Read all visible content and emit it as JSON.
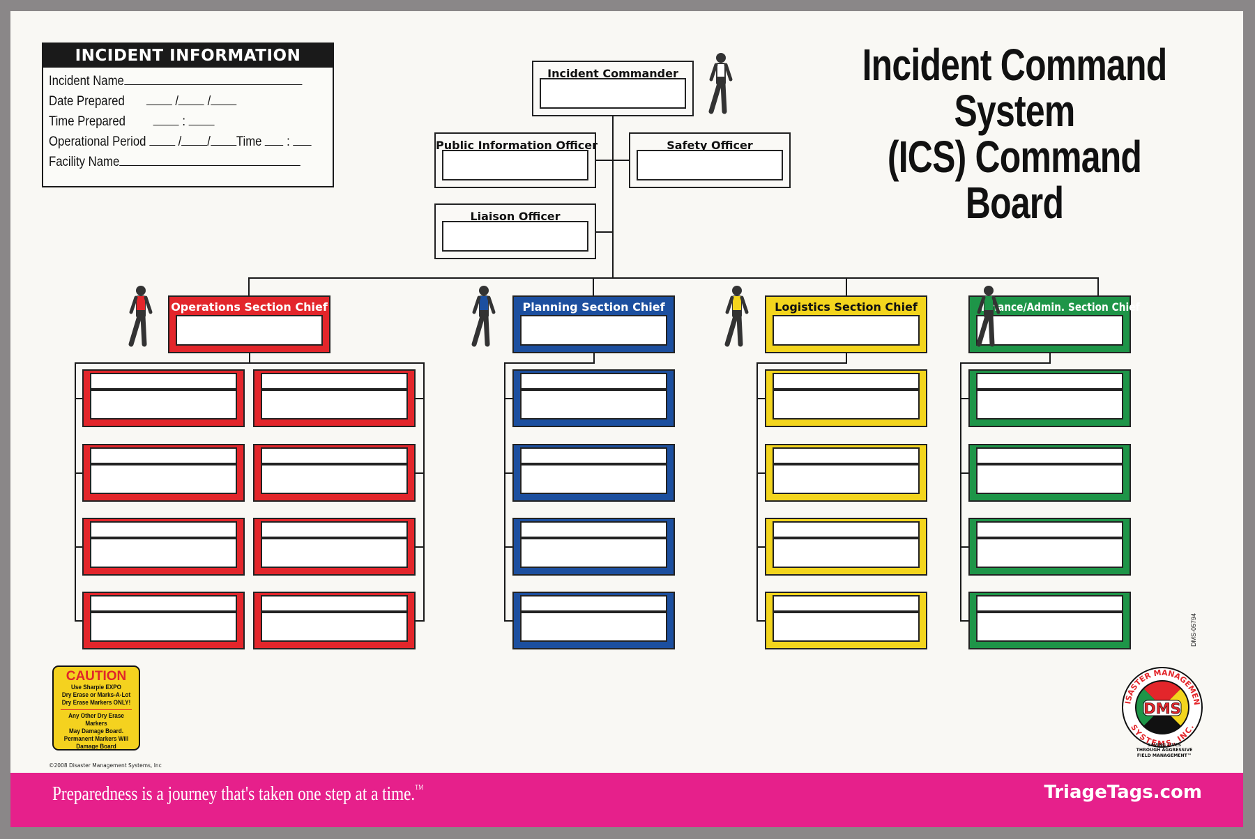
{
  "incident_info": {
    "header": "INCIDENT INFORMATION",
    "fields": {
      "incident_name": "Incident Name",
      "date_prepared": "Date Prepared",
      "time_prepared": "Time Prepared",
      "operational_period": "Operational Period",
      "op_time": "Time",
      "facility_name": "Facility Name"
    },
    "separators": {
      "slash": "/",
      "colon": ":"
    }
  },
  "title": {
    "line1": "Incident Command System",
    "line2": "(ICS) Command Board"
  },
  "command_staff": {
    "incident_commander": "Incident Commander",
    "public_information_officer": "Public Information Officer",
    "safety_officer": "Safety Officer",
    "liaison_officer": "Liaison Officer"
  },
  "sections": [
    {
      "id": "operations",
      "label": "Operations Section Chief",
      "color": "#e3262b",
      "text_color": "#ffffff",
      "unit_boxes": 8
    },
    {
      "id": "planning",
      "label": "Planning Section Chief",
      "color": "#1c4f9f",
      "text_color": "#ffffff",
      "unit_boxes": 4
    },
    {
      "id": "logistics",
      "label": "Logistics Section Chief",
      "color": "#f3d51d",
      "text_color": "#111111",
      "unit_boxes": 4
    },
    {
      "id": "finance",
      "label": "Finance/Admin. Section Chief",
      "color": "#1e9548",
      "text_color": "#ffffff",
      "unit_boxes": 4
    }
  ],
  "caution": {
    "heading": "CAUTION",
    "line1": "Use Sharpie EXPO",
    "line2": "Dry Erase or Marks-A-Lot",
    "line3": "Dry Erase Markers ONLY!",
    "line4": "Any Other Dry Erase Markers",
    "line5": "May Damage Board.",
    "line6": "Permanent Markers Will",
    "line7": "Damage Board"
  },
  "copyright": "©2008 Disaster Management Systems, Inc",
  "product_code": "DMS-05794",
  "logo": {
    "ring_top": "DISASTER MANAGEMENT",
    "ring_bottom": "SYSTEMS, INC.",
    "center": "DMS",
    "registered": "®",
    "tagline1": "SAVING LIVES",
    "tagline2": "THROUGH AGGRESSIVE",
    "tagline3": "FIELD MANAGEMENT™"
  },
  "footer": {
    "slogan": "Preparedness is a journey that's taken one step at a time.",
    "tm": "TM",
    "website": "TriageTags.com",
    "color": "#e6208b"
  }
}
